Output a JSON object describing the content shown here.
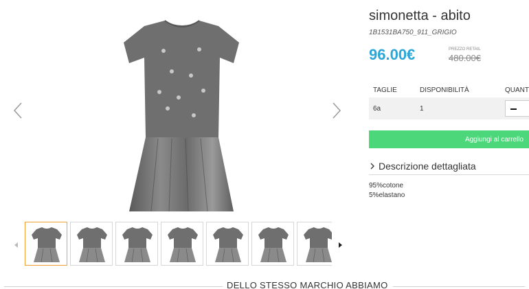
{
  "product": {
    "title": "simonetta - abito",
    "sku": "1B1531BA750_911_GRIGIO",
    "price": "96.00€",
    "retail_label": "PREZZO RETAIL",
    "retail_price": "480.00€"
  },
  "table": {
    "headers": [
      "TAGLIE",
      "DISPONIBILITÀ",
      "QUANT"
    ],
    "rows": [
      {
        "size": "6a",
        "availability": "1"
      }
    ],
    "minus_icon": "minus-icon"
  },
  "cart_button_label": "Aggiungi al carrello",
  "description": {
    "heading": "Descrizione dettagliata",
    "toggle_icon": "chevron-right-icon",
    "lines": [
      "95%cotone",
      "5%elastano"
    ]
  },
  "gallery": {
    "thumbnail_count": 7,
    "active_index": 0,
    "nav_icons": [
      "chevron-left-icon",
      "chevron-right-icon",
      "caret-left-icon",
      "caret-right-icon"
    ]
  },
  "related_heading": "DELLO STESSO MARCHIO ABBIAMO",
  "colors": {
    "price": "#2aa7d8",
    "cart_button": "#4cd87a",
    "active_thumb_border": "#f0a030"
  }
}
